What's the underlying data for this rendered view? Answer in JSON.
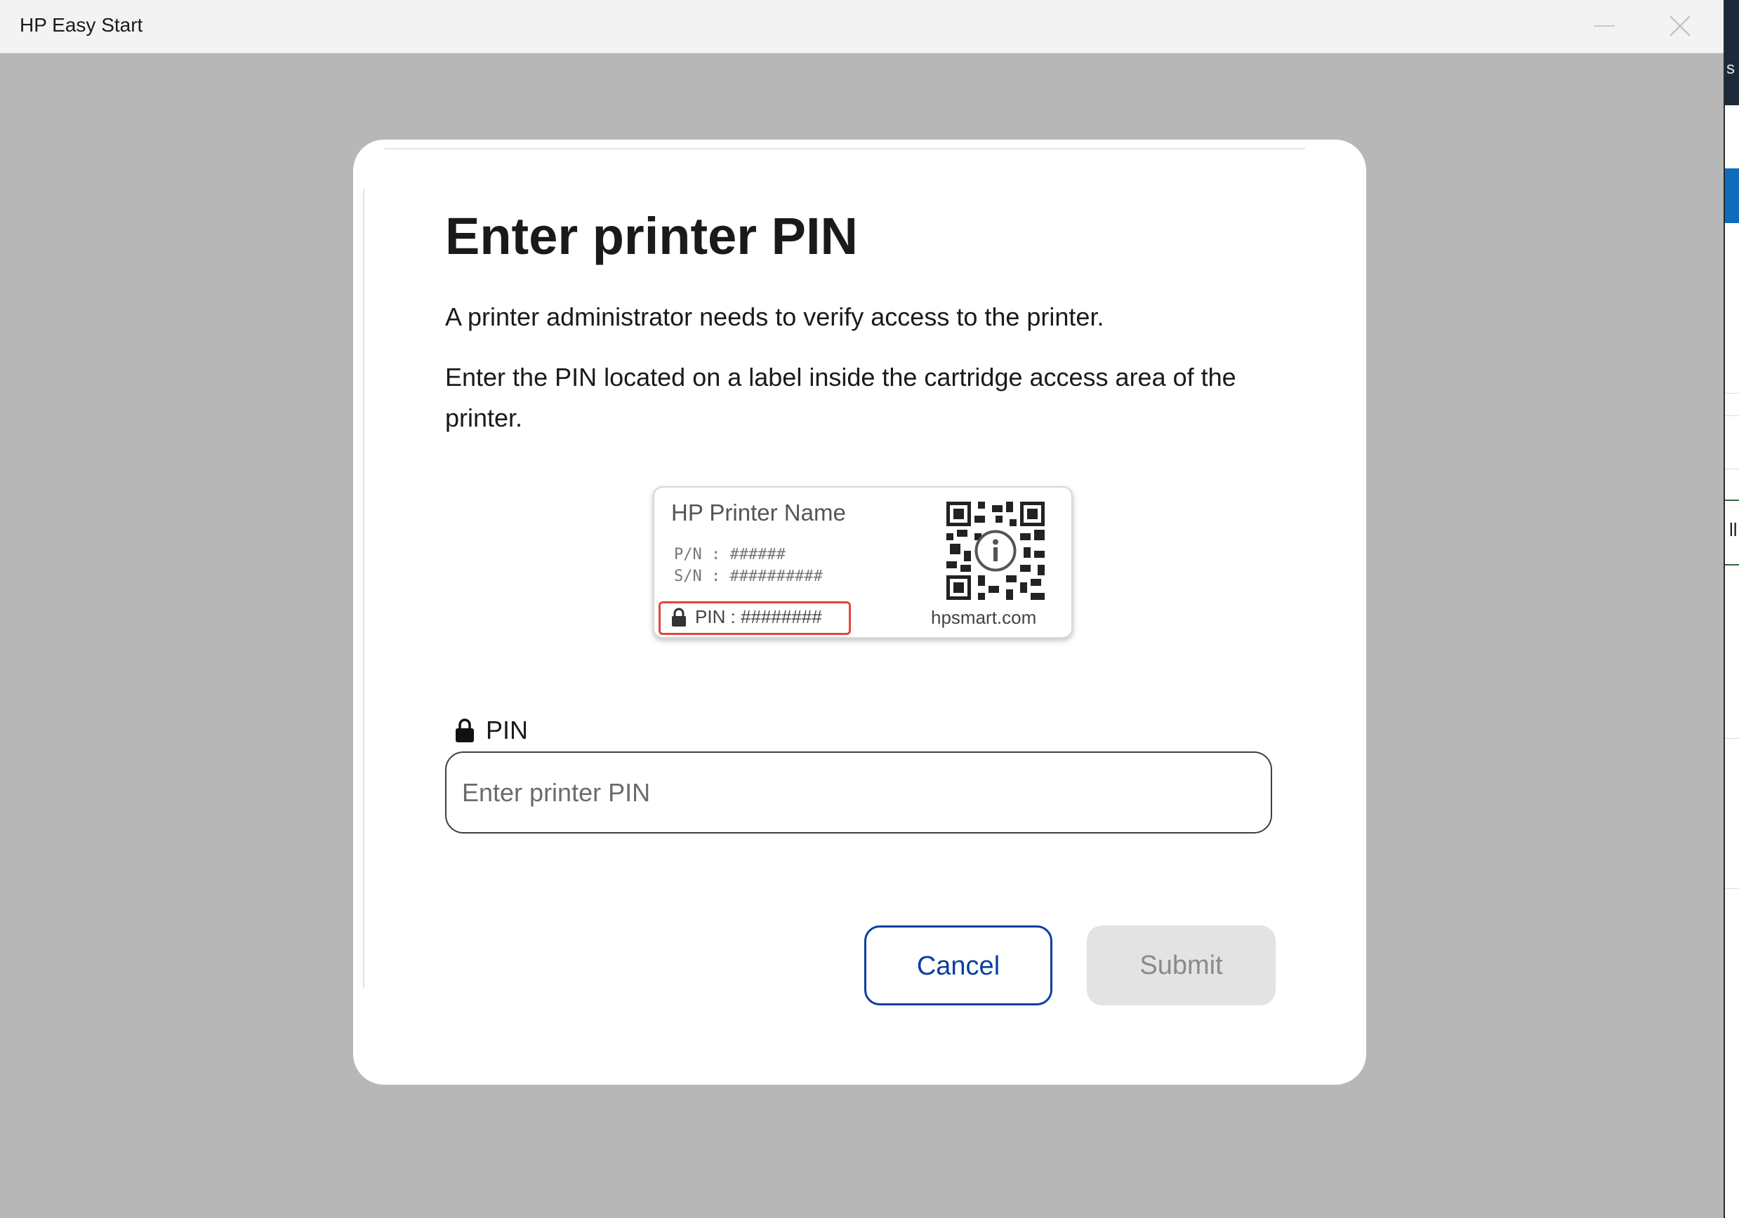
{
  "window": {
    "title": "HP Easy Start"
  },
  "dialog": {
    "title": "Enter printer PIN",
    "text_1": "A printer administrator needs to verify access to the printer.",
    "text_2": "Enter the PIN located on a label inside the cartridge access area of the printer."
  },
  "label_illustration": {
    "printer_name": "HP Printer Name",
    "pn": "P/N : ######",
    "sn": "S/N : ##########",
    "pin": "PIN : ########",
    "url": "hpsmart.com"
  },
  "pin_field": {
    "label": "PIN",
    "value": "",
    "placeholder": "Enter printer PIN"
  },
  "buttons": {
    "cancel": "Cancel",
    "submit": "Submit",
    "submit_enabled": false
  },
  "background_window": {
    "partial_glyph_top": "s",
    "partial_glyph_mid": "ll"
  },
  "colors": {
    "overlay": "#b7b7b7",
    "accent": "#0a3fa0",
    "highlight": "#e2463c",
    "disabled": "#e3e3e3"
  }
}
